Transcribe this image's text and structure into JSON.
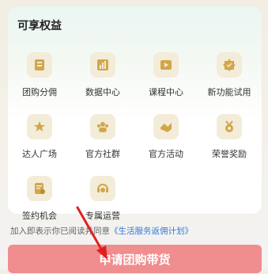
{
  "section": {
    "title": "可享权益"
  },
  "benefits": [
    {
      "label": "团购分佣",
      "icon": "group-commission-icon"
    },
    {
      "label": "数据中心",
      "icon": "data-center-icon"
    },
    {
      "label": "课程中心",
      "icon": "course-center-icon"
    },
    {
      "label": "新功能试用",
      "icon": "new-feature-trial-icon"
    },
    {
      "label": "达人广场",
      "icon": "creator-square-icon"
    },
    {
      "label": "官方社群",
      "icon": "official-community-icon"
    },
    {
      "label": "官方活动",
      "icon": "official-activity-icon"
    },
    {
      "label": "荣誉奖励",
      "icon": "honor-award-icon"
    },
    {
      "label": "签约机会",
      "icon": "contract-opportunity-icon"
    },
    {
      "label": "专属运营",
      "icon": "dedicated-operation-icon"
    }
  ],
  "agreement": {
    "prefix": "加入即表示你已阅读并同意",
    "link": "《生活服务返佣计划》"
  },
  "cta": {
    "label": "申请团购带货"
  },
  "colors": {
    "icon_bg": "#f3ecd9",
    "icon_fg": "#d3a64a",
    "button": "#f08d8f",
    "link": "#2f7bd8",
    "arrow": "#e0201f"
  }
}
